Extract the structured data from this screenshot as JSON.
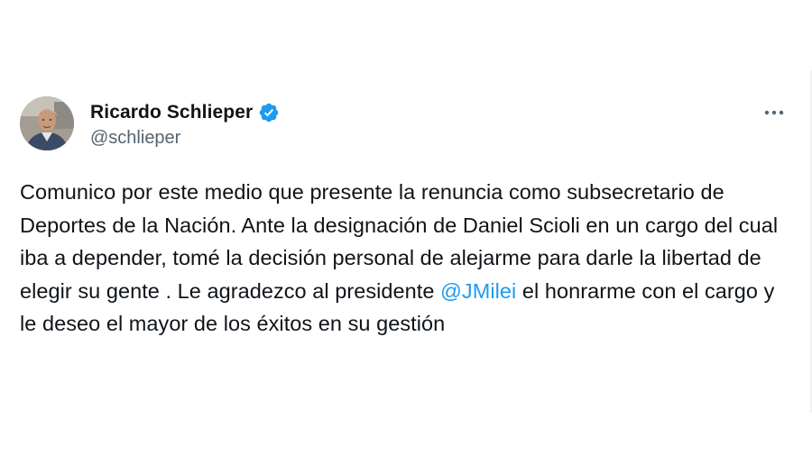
{
  "tweet": {
    "author": {
      "display_name": "Ricardo Schlieper",
      "handle": "@schlieper",
      "verified": true
    },
    "text": {
      "part1": "Comunico por este medio que presente la renuncia como subsecretario de Deportes de la Nación. Ante la designación de Daniel Scioli en un cargo del cual iba a depender, tomé la decisión personal de alejarme para darle la libertad de elegir su gente . Le agradezco al presidente ",
      "mention": "@JMilei",
      "part2": " el honrarme con el cargo y le deseo el mayor de los éxitos en su gestión"
    }
  },
  "colors": {
    "text_primary": "#0f1419",
    "text_secondary": "#536471",
    "accent_blue": "#1d9bf0"
  },
  "icons": {
    "verified": "verified-badge-icon",
    "more": "more-options-icon"
  }
}
